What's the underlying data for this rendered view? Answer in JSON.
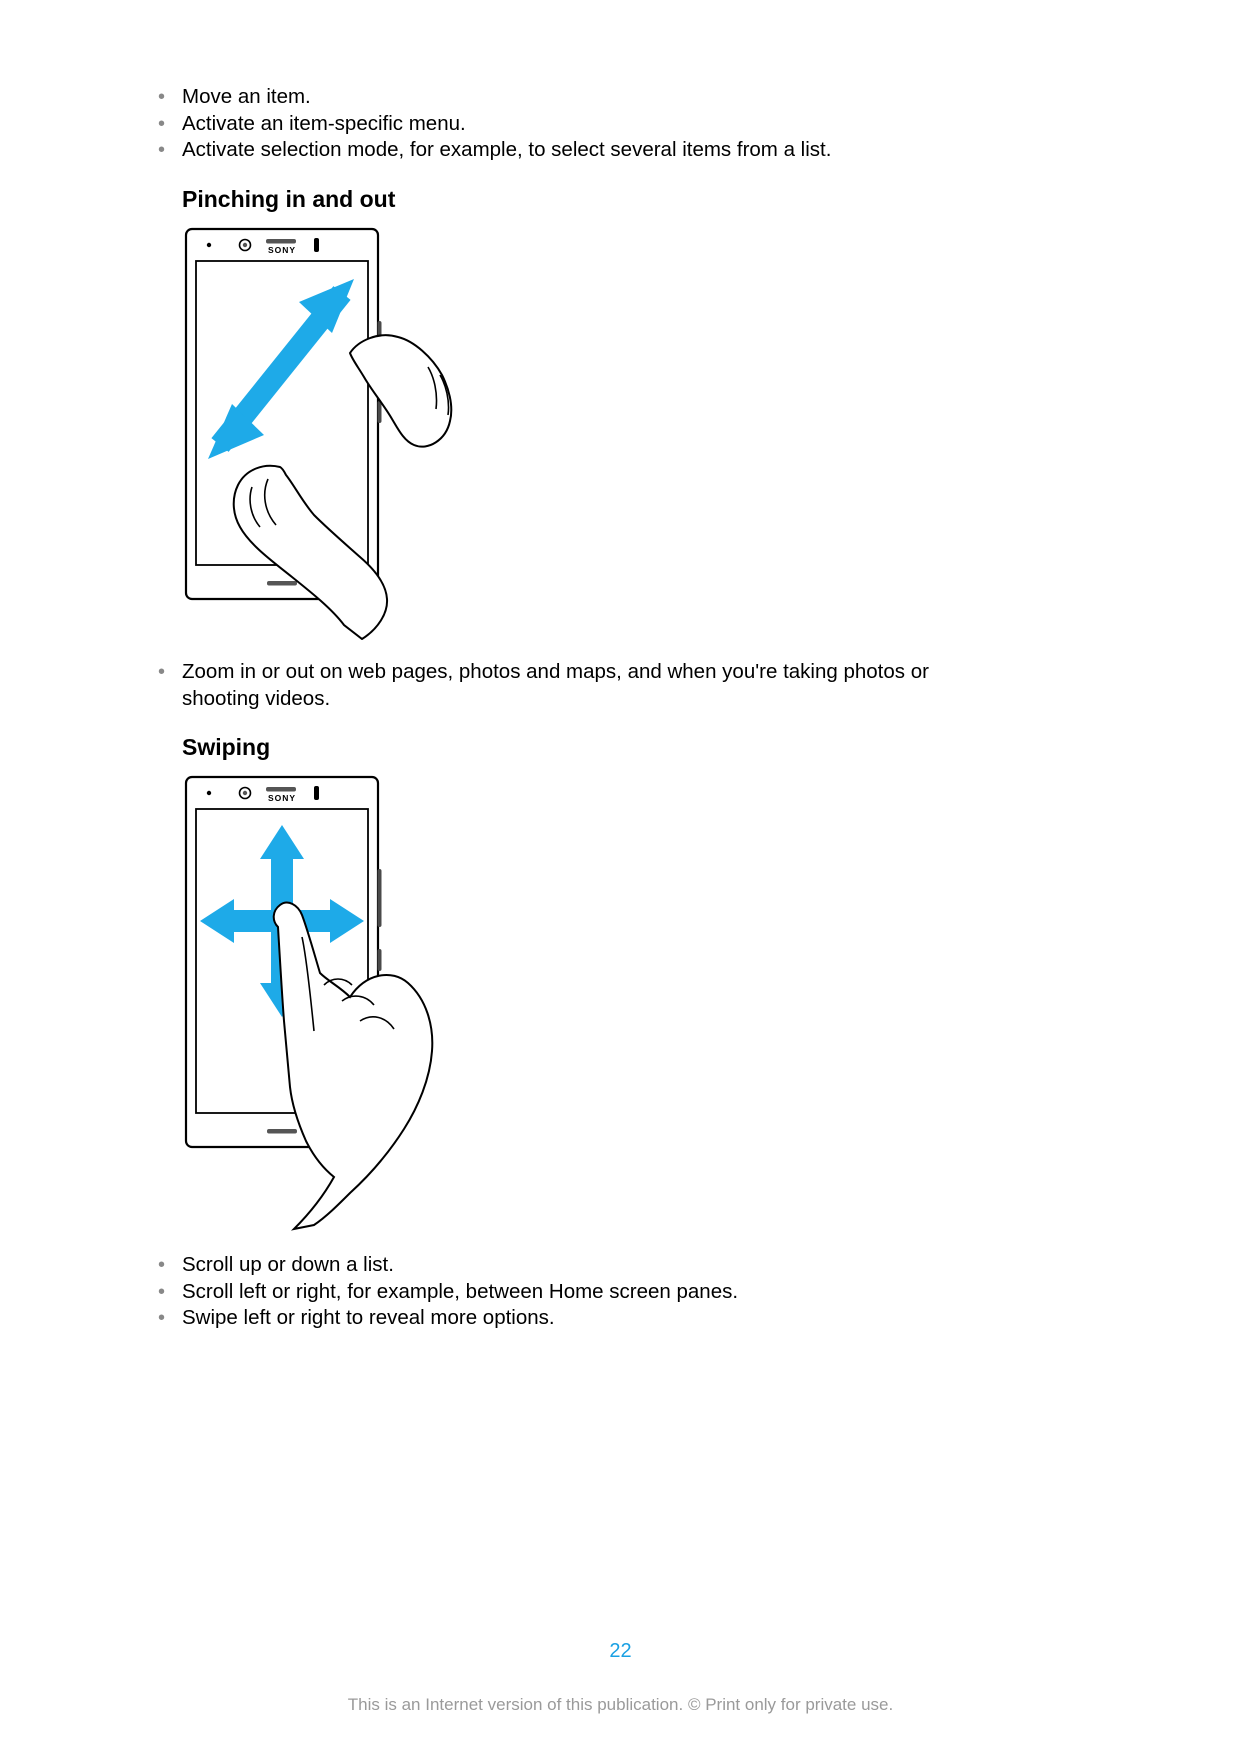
{
  "bullets_top": [
    "Move an item.",
    "Activate an item-specific menu.",
    "Activate selection mode, for example, to select several items from a list."
  ],
  "section_pinch": {
    "heading": "Pinching in and out"
  },
  "bullets_pinch": [
    "Zoom in or out on web pages, photos and maps, and when you're taking photos or shooting videos."
  ],
  "section_swipe": {
    "heading": "Swiping"
  },
  "bullets_swipe": [
    "Scroll up or down a list.",
    "Scroll left or right, for example, between Home screen panes.",
    "Swipe left or right to reveal more options."
  ],
  "page_number": "22",
  "footer": "This is an Internet version of this publication. © Print only for private use.",
  "phone_brand": "SONY",
  "colors": {
    "accent": "#19a0e3",
    "arrow": "#1eaae8"
  }
}
